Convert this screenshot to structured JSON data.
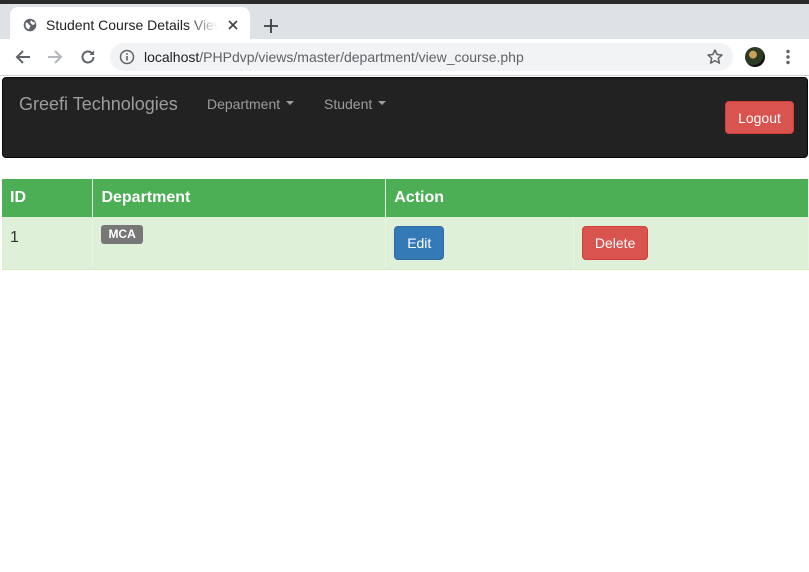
{
  "browser": {
    "tab_title": "Student Course Details View",
    "new_tab_label": "+",
    "url_host": "localhost",
    "url_path": "/PHPdvp/views/master/department/view_course.php"
  },
  "navbar": {
    "brand": "Greefi Technologies",
    "menu_department": "Department",
    "menu_student": "Student",
    "logout_label": "Logout"
  },
  "table": {
    "headers": [
      "ID",
      "Department",
      "Action"
    ],
    "rows": [
      {
        "id": "1",
        "department": "MCA",
        "edit_label": "Edit",
        "delete_label": "Delete"
      }
    ]
  },
  "colors": {
    "navbar_bg": "#222222",
    "table_header_bg": "#4cae55",
    "row_bg": "#dff0d8",
    "edit_button": "#337ab7",
    "delete_button": "#d9534f",
    "label_bg": "#777777"
  }
}
